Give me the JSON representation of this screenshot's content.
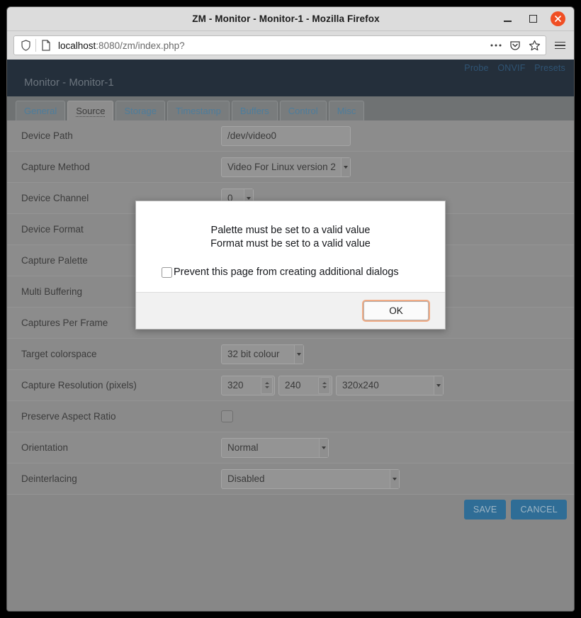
{
  "window": {
    "title": "ZM - Monitor - Monitor-1 - Mozilla Firefox",
    "minimize_icon": "minimize-icon",
    "maximize_icon": "maximize-icon",
    "close_icon": "close-icon"
  },
  "browser": {
    "url_prefix": "localhost",
    "url_suffix": ":8080/zm/index.php?",
    "shield_icon": "shield-icon",
    "page_icon": "page-icon",
    "more_icon": "ellipsis-icon",
    "pocket_icon": "pocket-icon",
    "bookmark_icon": "star-icon",
    "menu_icon": "hamburger-menu-icon"
  },
  "zm_header": {
    "title": "Monitor - Monitor-1",
    "links": [
      "Probe",
      "ONVIF",
      "Presets"
    ]
  },
  "tabs": [
    {
      "label": "General",
      "active": false
    },
    {
      "label": "Source",
      "active": true
    },
    {
      "label": "Storage",
      "active": false
    },
    {
      "label": "Timestamp",
      "active": false
    },
    {
      "label": "Buffers",
      "active": false
    },
    {
      "label": "Control",
      "active": false
    },
    {
      "label": "Misc",
      "active": false
    }
  ],
  "form": {
    "rows": [
      {
        "label": "Device Path",
        "value": "/dev/video0"
      },
      {
        "label": "Capture Method",
        "value": "Video For Linux version 2"
      },
      {
        "label": "Device Channel",
        "value": "0"
      },
      {
        "label": "Device Format",
        "value": ""
      },
      {
        "label": "Capture Palette",
        "value": ""
      },
      {
        "label": "Multi Buffering",
        "value": ""
      },
      {
        "label": "Captures Per Frame",
        "value": ""
      },
      {
        "label": "Target colorspace",
        "value": "32 bit colour"
      },
      {
        "label": "Capture Resolution (pixels)",
        "width": "320",
        "height": "240",
        "preset": "320x240"
      },
      {
        "label": "Preserve Aspect Ratio",
        "checked": false
      },
      {
        "label": "Orientation",
        "value": "Normal"
      },
      {
        "label": "Deinterlacing",
        "value": "Disabled"
      }
    ]
  },
  "actions": {
    "save_label": "SAVE",
    "cancel_label": "CANCEL"
  },
  "dialog": {
    "message_line1": "Palette must be set to a valid value",
    "message_line2": "Format must be set to a valid value",
    "checkbox_label": "Prevent this page from creating additional dialogs",
    "checkbox_checked": false,
    "ok_label": "OK"
  },
  "colors": {
    "header_bg": "#242f3b",
    "page_bg": "#878787",
    "accent_button": "#2f6d96",
    "focus_ring": "#f0ab85",
    "close_button": "#f04e23",
    "tab_link": "#4d7d9c"
  }
}
